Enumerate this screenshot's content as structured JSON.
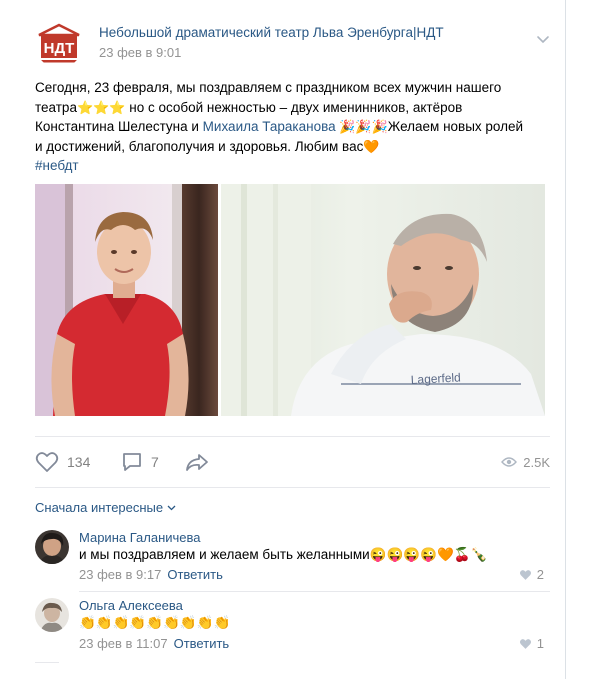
{
  "post": {
    "author": "Небольшой драматический театр Льва Эренбурга|НДТ",
    "date": "23 фев в 9:01",
    "logo_text": "НДТ",
    "text_line1": "Сегодня, 23 февраля, мы поздравляем с праздником всех мужчин нашего",
    "text_line2_a": "театра",
    "text_line2_emoji": "⭐⭐⭐",
    "text_line2_b": " но с особой нежностью – двух именинников, актёров",
    "text_line3_a": "Константина Шелестуна и ",
    "text_line3_link": "Михаила Тараканова",
    "text_line3_emoji": " 🎉🎉🎉",
    "text_line3_b": "Желаем новых ролей",
    "text_line4": "и достижений, благополучия и здоровья. Любим вас",
    "text_line4_emoji": "🧡",
    "hashtag": "#небдт"
  },
  "actions": {
    "likes": "134",
    "comments": "7",
    "views": "2.5K"
  },
  "sort_label": "Сначала интересные",
  "comments": [
    {
      "name": "Марина Галаничева",
      "text": "и мы поздравляем и желаем быть желанными",
      "emoji": "😜😜😜😜🧡🍒🍾",
      "date": "23 фев в 9:17",
      "reply": "Ответить",
      "likes": "2"
    },
    {
      "name": "Ольга Алексеева",
      "text": "",
      "emoji": "👏👏👏👏👏👏👏👏👏",
      "date": "23 фев в 11:07",
      "reply": "Ответить",
      "likes": "1"
    }
  ],
  "colors": {
    "link": "#2a5885",
    "muted": "#939393",
    "logo_red": "#c0392b"
  }
}
